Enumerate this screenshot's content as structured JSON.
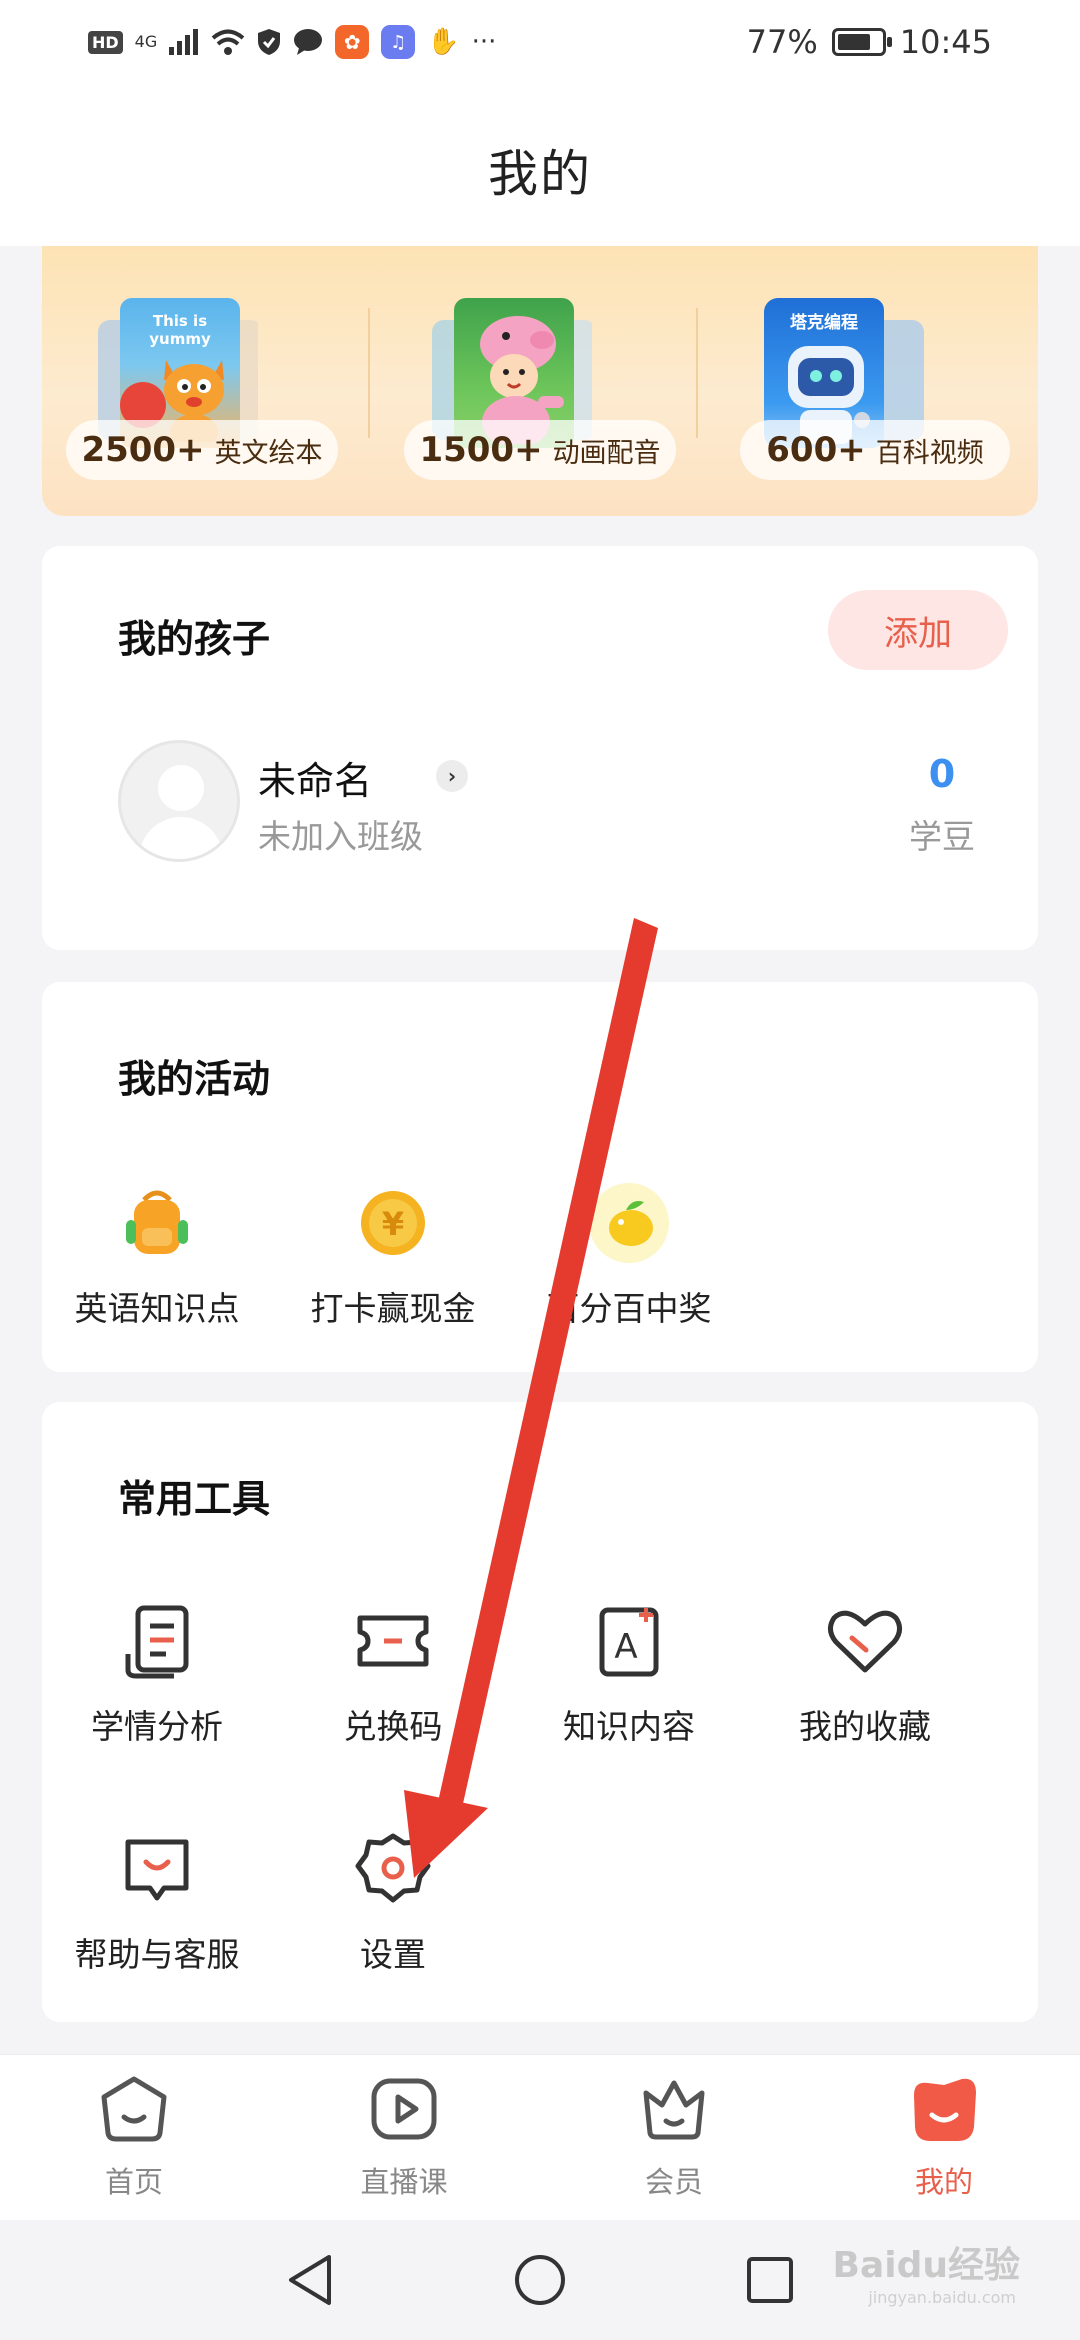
{
  "status_bar": {
    "hd": "HD",
    "network": "4G",
    "battery_text": "77%",
    "battery_level": 0.77,
    "time": "10:45",
    "more": "···"
  },
  "header": {
    "title": "我的"
  },
  "promo": {
    "items": [
      {
        "number": "2500+",
        "label": "英文绘本",
        "cover_caption": "This is yummy"
      },
      {
        "number": "1500+",
        "label": "动画配音"
      },
      {
        "number": "600+",
        "label": "百科视频",
        "cover_caption": "塔克编程"
      }
    ]
  },
  "children": {
    "title": "我的孩子",
    "add_label": "添加",
    "child_name": "未命名",
    "child_class": "未加入班级",
    "bean_count": "0",
    "bean_label": "学豆"
  },
  "activities": {
    "title": "我的活动",
    "items": [
      {
        "label": "英语知识点",
        "icon": "backpack-icon"
      },
      {
        "label": "打卡赢现金",
        "icon": "yuan-coin-icon"
      },
      {
        "label": "百分百中奖",
        "icon": "lemon-icon"
      }
    ]
  },
  "tools": {
    "title": "常用工具",
    "items": [
      {
        "label": "学情分析",
        "icon": "report-icon"
      },
      {
        "label": "兑换码",
        "icon": "ticket-icon"
      },
      {
        "label": "知识内容",
        "icon": "knowledge-icon"
      },
      {
        "label": "我的收藏",
        "icon": "heart-icon"
      },
      {
        "label": "帮助与客服",
        "icon": "support-icon"
      },
      {
        "label": "设置",
        "icon": "gear-icon"
      }
    ]
  },
  "bottom_nav": {
    "items": [
      {
        "label": "首页",
        "icon": "home-icon"
      },
      {
        "label": "直播课",
        "icon": "live-play-icon"
      },
      {
        "label": "会员",
        "icon": "crown-icon"
      },
      {
        "label": "我的",
        "icon": "profile-face-icon",
        "active": true
      }
    ]
  },
  "watermark": {
    "text": "Baidu经验",
    "sub": "jingyan.baidu.com"
  },
  "colors": {
    "accent": "#e8604c",
    "bean_blue": "#3d8ff0",
    "annotation_arrow": "#e53a2e"
  }
}
